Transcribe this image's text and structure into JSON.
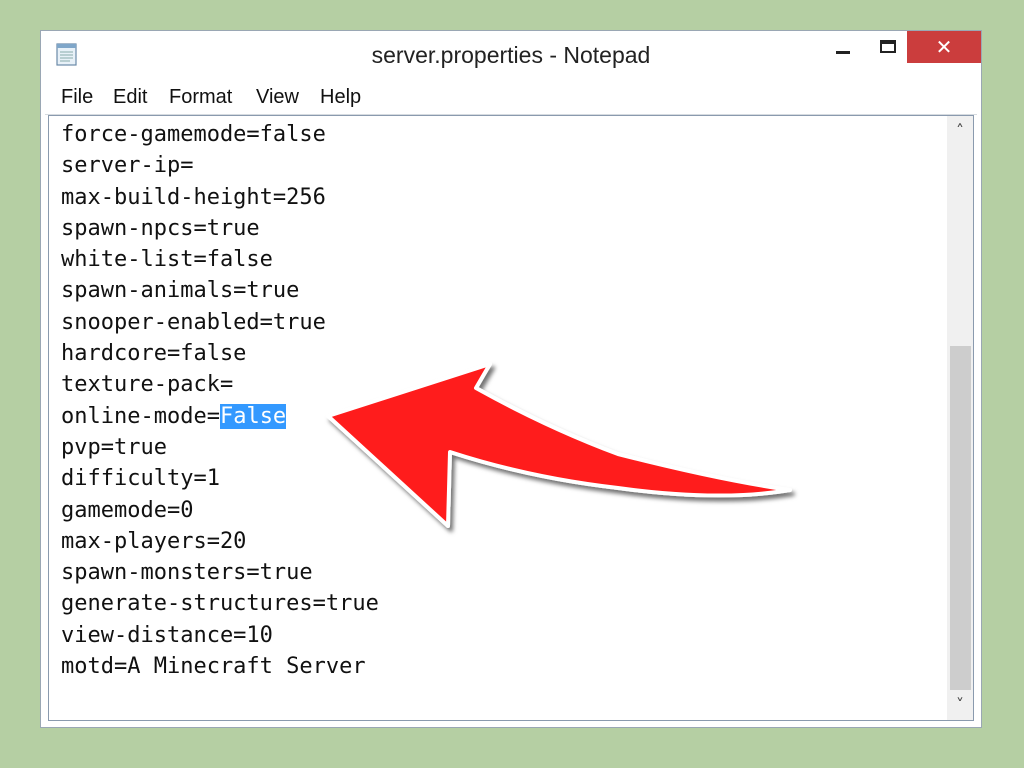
{
  "window": {
    "title": "server.properties - Notepad",
    "close_glyph": "✕",
    "accent_close": "#cb3d3d",
    "selection_color": "#3399ff"
  },
  "menu": {
    "items": [
      "File",
      "Edit",
      "Format",
      "View",
      "Help"
    ]
  },
  "editor": {
    "lines_before": [
      "force-gamemode=false",
      "server-ip=",
      "max-build-height=256",
      "spawn-npcs=true",
      "white-list=false",
      "spawn-animals=true",
      "snooper-enabled=true",
      "hardcore=false",
      "texture-pack="
    ],
    "selected_line_prefix": "online-mode=",
    "selected_text": "False",
    "lines_after": [
      "pvp=true",
      "difficulty=1",
      "gamemode=0",
      "max-players=20",
      "spawn-monsters=true",
      "generate-structures=true",
      "view-distance=10",
      "motd=A Minecraft Server"
    ]
  },
  "scrollbar": {
    "up_glyph": "˄",
    "down_glyph": "˅"
  },
  "annotation": {
    "arrow_color": "#ff1a1a"
  }
}
